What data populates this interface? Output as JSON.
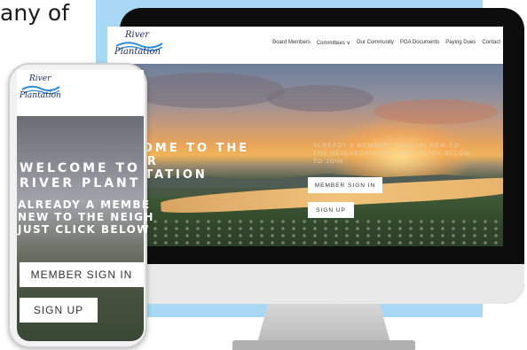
{
  "intro": {
    "text": "any of"
  },
  "site": {
    "logo": {
      "line1": "River",
      "line2": "Plantation"
    },
    "nav": [
      "Board Members",
      "Committees ∨",
      "Our Community",
      "POA Documents",
      "Paying Dues",
      "Contact"
    ]
  },
  "desktop_hero": {
    "title_lines": [
      "ELCOME TO THE",
      "IVER",
      "LANTATION"
    ],
    "subtitle_lines": [
      "ALREADY A MEMBER? SIGN IN! NEW TO",
      "THE NEIGHBORHOOD? JUST CLICK BELOW",
      "TO JOIN"
    ],
    "member_button": "MEMBER SIGN IN",
    "signup_button": "SIGN UP"
  },
  "mobile_hero": {
    "title_lines": [
      "WELCOME TO",
      "RIVER PLANT"
    ],
    "subtitle_lines": [
      "ALREADY A MEMBE",
      "NEW TO THE NEIGH",
      "JUST CLICK BELOW"
    ],
    "member_button": "MEMBER SIGN IN",
    "signup_button": "SIGN UP"
  },
  "colors": {
    "accent_panel": "#a8d8f4",
    "logo_navy": "#1c2b5a",
    "logo_wave": "#2f8ad6"
  }
}
